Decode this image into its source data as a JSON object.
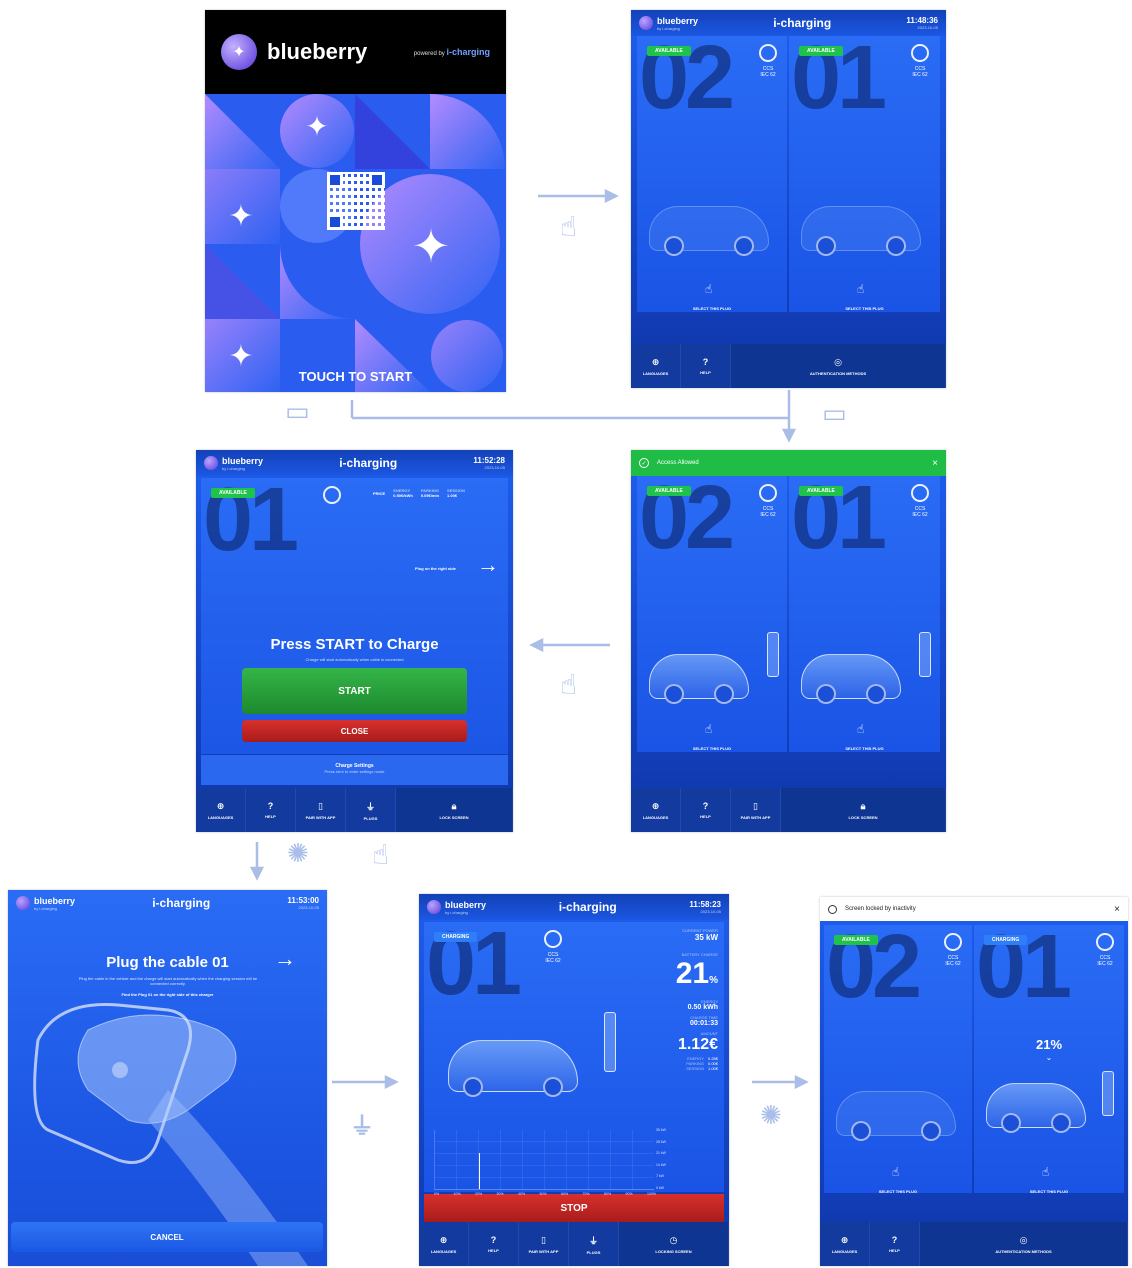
{
  "screen1": {
    "brand": "blueberry",
    "powered": "powered by",
    "powered_brand": "i-charging",
    "touch": "TOUCH TO START"
  },
  "header": {
    "brand": "blueberry",
    "brand_sub": "by i-charging",
    "title": "i-charging",
    "date": "2023-10-05"
  },
  "screen2": {
    "time": "11:48:36",
    "plug_a": "02",
    "plug_b": "01",
    "badge": "AVAILABLE",
    "connector": "CCS",
    "connector_sub": "IEC 62",
    "select": "SELECT THIS PLUG"
  },
  "footer": {
    "languages": "LANGUAGES",
    "help": "HELP",
    "auth": "AUTHENTICATION METHODS",
    "pair": "PAIR WITH APP",
    "plugs": "PLUGS",
    "lock": "LOCK SCREEN",
    "locking": "LOCKING SCREEN"
  },
  "screen3": {
    "time": "11:52:28",
    "plug": "01",
    "badge": "AVAILABLE",
    "price_label": "PRICE",
    "prices": [
      {
        "k": "ENERGY",
        "v": "0.50€/kWh"
      },
      {
        "k": "PARKING",
        "v": "0.05€/min"
      },
      {
        "k": "SESSION",
        "v": "1.00€"
      }
    ],
    "plug_hint": "Plug on the right side",
    "title": "Press START to Charge",
    "subtitle": "Charge will start automatically when cable is connected",
    "start": "START",
    "close": "CLOSE",
    "settings": "Charge Settings",
    "settings_sub": "Press here to enter settings mode"
  },
  "screen4": {
    "banner": "Access Allowed",
    "close": "×"
  },
  "screen5": {
    "time": "11:53:00",
    "title": "Plug the cable 01",
    "desc": "Plug the cable in the vehicle and the charge will start automatically when the charging session will be connected correctly.",
    "hint": "Find the Plug 01 on the right side of this charger",
    "cancel": "CANCEL"
  },
  "screen6": {
    "time": "11:58:23",
    "badge": "CHARGING",
    "plug": "01",
    "power_label": "CURRENT POWER",
    "power": "35 kW",
    "battery_label": "BATTERY CHARGE",
    "battery": "21",
    "battery_unit": "%",
    "energy_label": "ENERGY",
    "energy": "0.50 kWh",
    "time_label": "CHARGE TIME",
    "elapsed": "00:01:33",
    "amount_label": "AMOUNT",
    "amount": "1.12€",
    "amount_rows": [
      {
        "k": "ENERGY",
        "v": "0.25€"
      },
      {
        "k": "PARKING",
        "v": "0.00€"
      },
      {
        "k": "SESSION",
        "v": "1.00€"
      }
    ],
    "y_ticks": [
      "35 kW",
      "28 kW",
      "21 kW",
      "14 kW",
      "7 kW",
      "0 kW"
    ],
    "x_ticks": [
      "0%",
      "10%",
      "20%",
      "30%",
      "40%",
      "50%",
      "60%",
      "70%",
      "80%",
      "90%",
      "100%"
    ],
    "stop": "STOP"
  },
  "screen7": {
    "banner": "Screen locked by inactivity",
    "close": "×",
    "badge_a": "AVAILABLE",
    "badge_b": "CHARGING",
    "pct": "21%"
  },
  "colors": {
    "blue": "#1a55e6",
    "green": "#21a33a",
    "red": "#c41f1f",
    "dark": "#0c2f8f"
  }
}
